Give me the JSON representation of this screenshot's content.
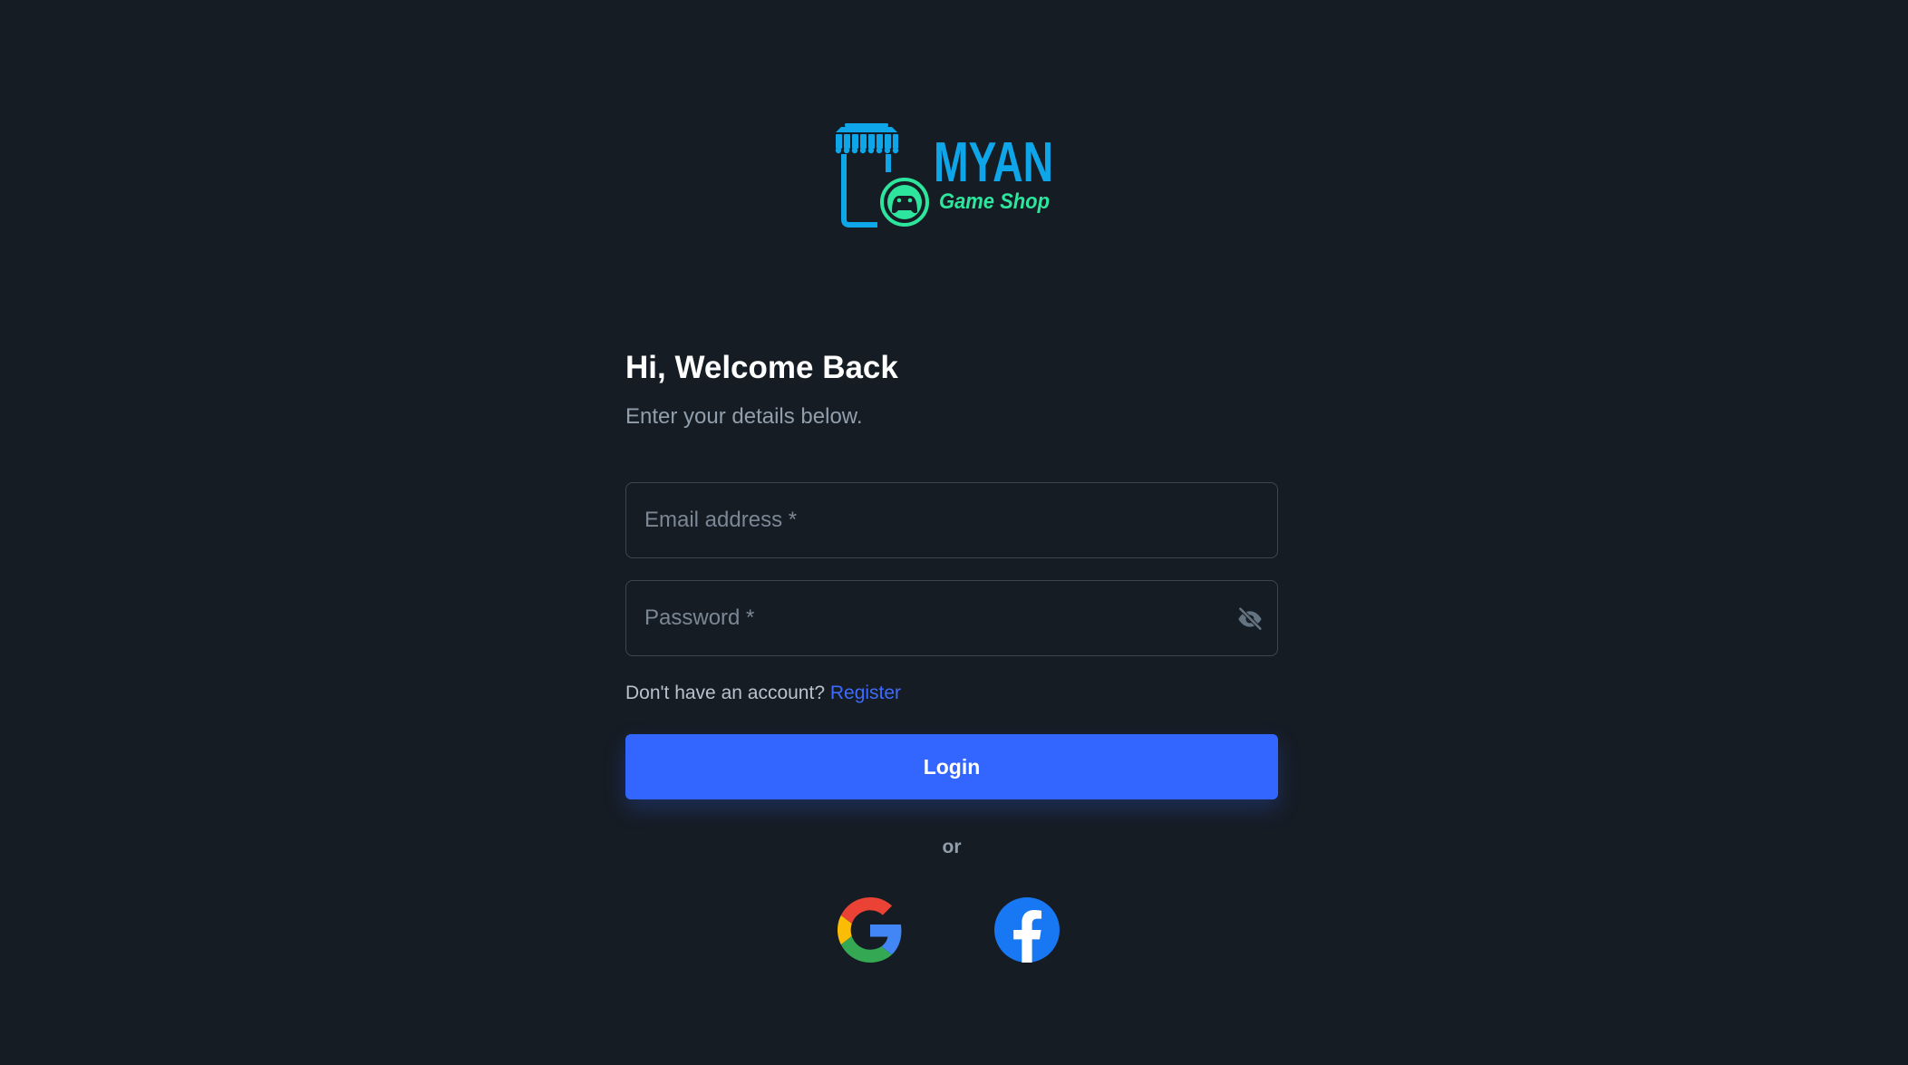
{
  "brand": {
    "name": "MYAN",
    "tagline": "Game Shop",
    "primary_color": "#0ea5e9",
    "accent_color": "#2ee59d"
  },
  "login": {
    "title": "Hi, Welcome Back",
    "subtitle": "Enter your details below.",
    "email_placeholder": "Email address *",
    "password_placeholder": "Password *",
    "no_account_text": "Don't have an account?",
    "register_link": "Register",
    "login_button": "Login",
    "divider_text": "or"
  },
  "social": {
    "google_icon": "google-icon",
    "facebook_icon": "facebook-icon"
  },
  "colors": {
    "background": "#161c24",
    "primary": "#3366ff",
    "link": "#3d6bff"
  }
}
